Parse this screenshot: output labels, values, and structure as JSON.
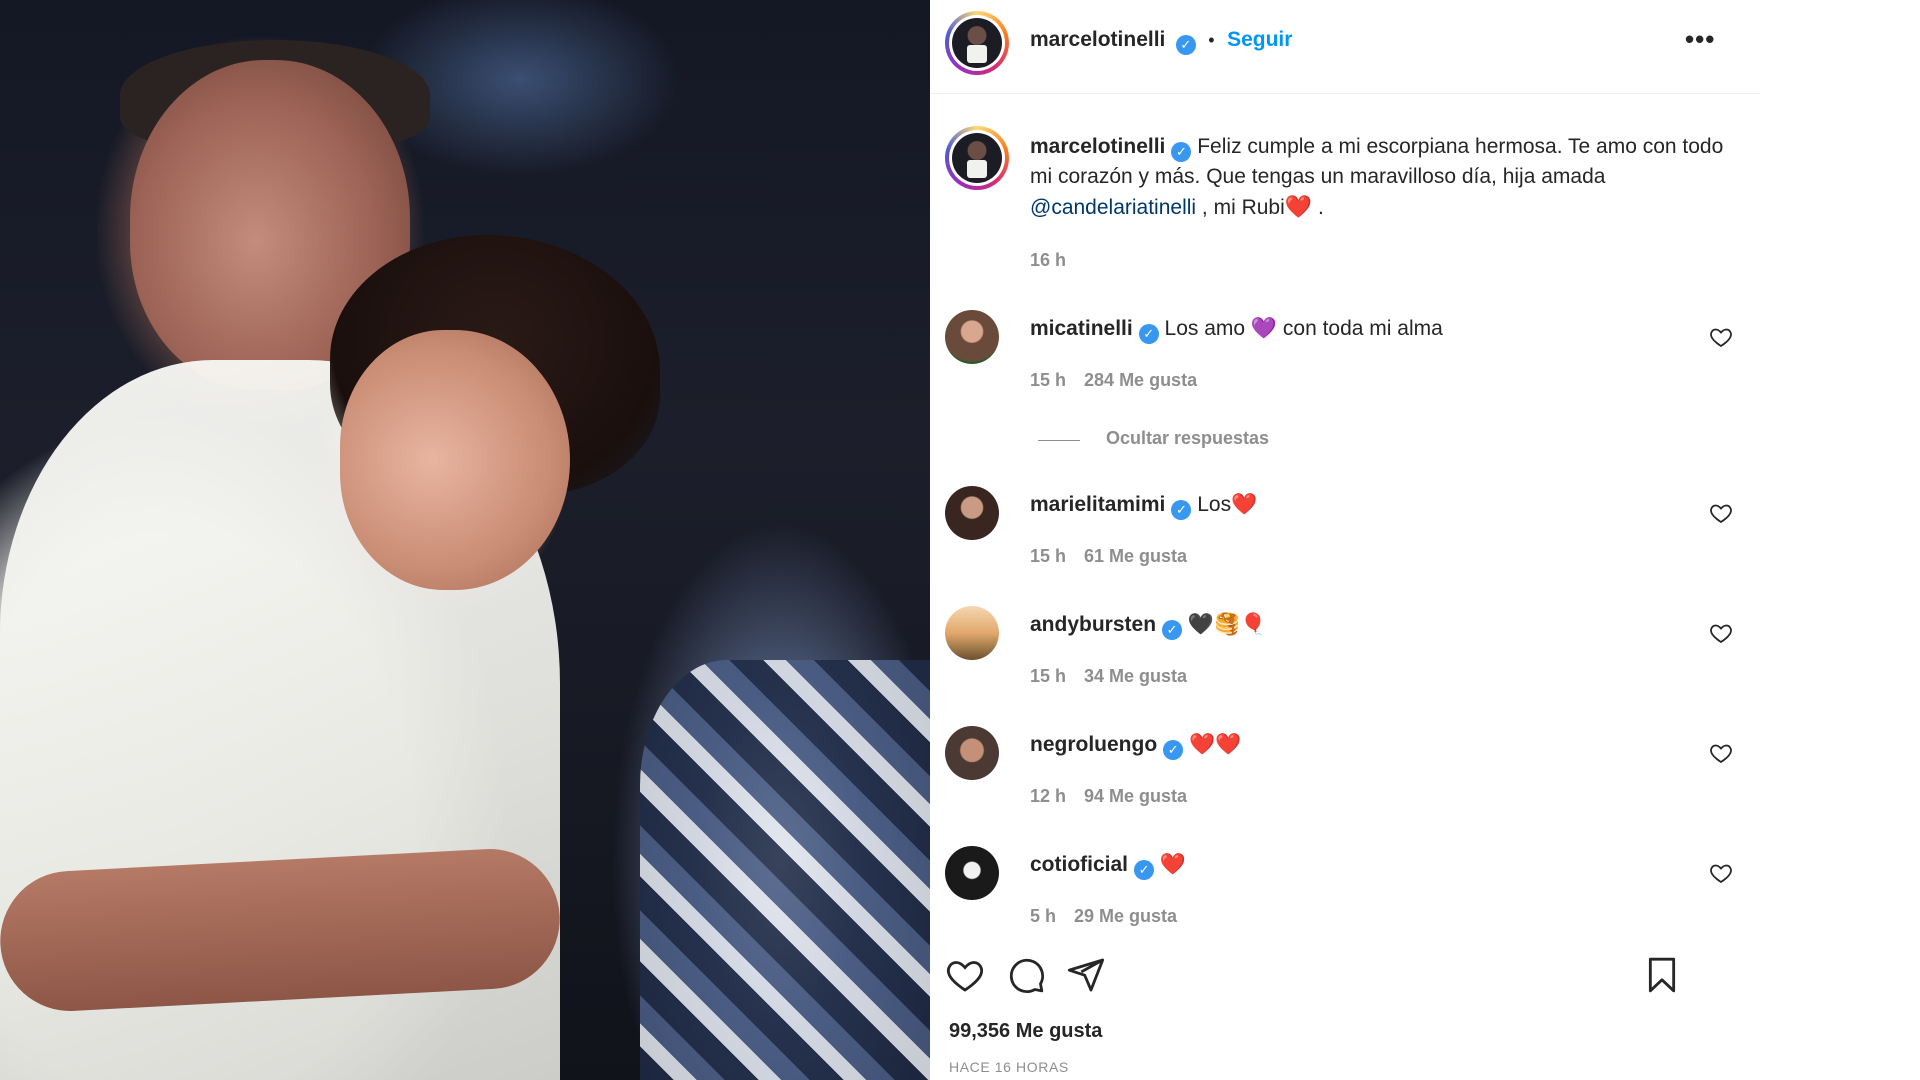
{
  "post": {
    "author": "marcelotinelli",
    "follow_label": "Seguir",
    "more_label": "•••",
    "caption": {
      "username": "marcelotinelli",
      "text_before": "Feliz cumple a mi escorpiana hermosa. Te amo con todo mi corazón y más. Que tengas un maravilloso día, hija amada ",
      "mention": "@candelariatinelli",
      "text_after": " , mi Rubi",
      "emoji": "❤️",
      "end": " .",
      "time": "16 h"
    },
    "hide_replies_label": "Ocultar respuestas",
    "likes": "99,356 Me gusta",
    "time_ago": "HACE 16 HORAS"
  },
  "comments": [
    {
      "username": "micatinelli",
      "text": "Los amo 💜 con toda mi alma",
      "time": "15 h",
      "likes": "284 Me gusta"
    },
    {
      "username": "marielitamimi",
      "text": "Los❤️",
      "time": "15 h",
      "likes": "61 Me gusta"
    },
    {
      "username": "andybursten",
      "text": "🖤🥞🎈",
      "time": "15 h",
      "likes": "34 Me gusta"
    },
    {
      "username": "negroluengo",
      "text": "❤️❤️",
      "time": "12 h",
      "likes": "94 Me gusta"
    },
    {
      "username": "cotioficial",
      "text": "❤️",
      "time": "5 h",
      "likes": "29 Me gusta"
    }
  ],
  "icons": {
    "verified": "✓",
    "like": "heart-icon",
    "comment": "comment-icon",
    "share": "share-icon",
    "save": "bookmark-icon"
  },
  "colors": {
    "link": "#0095f6",
    "verified": "#3897f0",
    "muted": "#8e8e8e",
    "text": "#262626"
  }
}
